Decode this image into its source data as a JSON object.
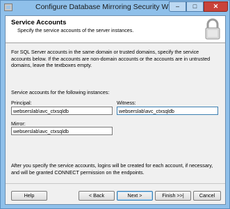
{
  "window": {
    "title": "Configure Database Mirroring Security Wizard",
    "controls": {
      "minimize": "–",
      "maximize": "□",
      "close": "✕"
    }
  },
  "header": {
    "title": "Service Accounts",
    "subtitle": "Specify the service accounts of the server instances."
  },
  "intro_text": "For SQL Server accounts in the same domain or trusted domains, specify the service accounts below. If the accounts are non-domain accounts or the accounts are in untrusted domains, leave the textboxes empty.",
  "service_heading": "Service accounts for the following instances:",
  "fields": {
    "principal": {
      "label": "Principal:",
      "value": "webserslab\\avc_ctxsqldb"
    },
    "witness": {
      "label": "Witness:",
      "value": "webserslab\\avc_ctxsqldb"
    },
    "mirror": {
      "label": "Mirror:",
      "value": "webserslab\\avc_ctxsqldb"
    }
  },
  "after_text": "After you specify the service accounts, logins will be created for each account, if necessary, and will be granted CONNECT permission on the endpoints.",
  "buttons": {
    "help": "Help",
    "back": "< Back",
    "next": "Next >",
    "finish": "Finish >>|",
    "cancel": "Cancel"
  },
  "icons": {
    "app": "wizard-app-icon",
    "header": "padlock-icon"
  }
}
